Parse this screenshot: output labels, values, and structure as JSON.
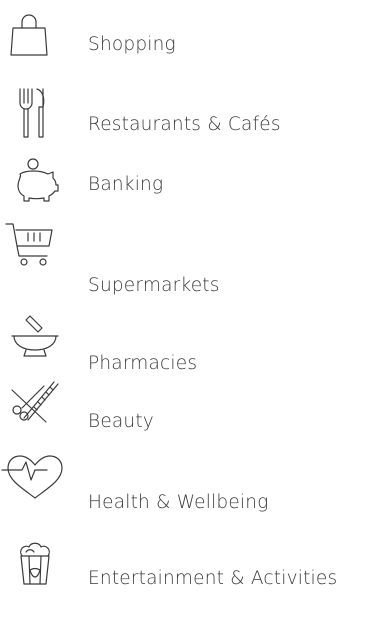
{
  "categories": [
    {
      "label": "Shopping",
      "icon": "shopping-bag-icon"
    },
    {
      "label": "Restaurants & Cafés",
      "icon": "fork-knife-icon"
    },
    {
      "label": "Banking",
      "icon": "piggy-bank-icon"
    },
    {
      "label": "Supermarkets",
      "icon": "shopping-cart-icon"
    },
    {
      "label": "Pharmacies",
      "icon": "mortar-pestle-icon"
    },
    {
      "label": "Beauty",
      "icon": "scissors-comb-icon"
    },
    {
      "label": "Health & Wellbeing",
      "icon": "heart-pulse-icon"
    },
    {
      "label": "Entertainment & Activities",
      "icon": "popcorn-icon"
    }
  ]
}
